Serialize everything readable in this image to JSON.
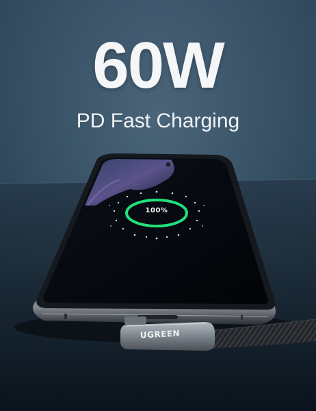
{
  "headline": "60W",
  "subtitle": "PD Fast Charging",
  "charge_indicator": {
    "percent_label": "100%",
    "ring_color": "#22e07a"
  },
  "brand_label": "UGREEN",
  "colors": {
    "background_top": "#2c4459",
    "background_bottom": "#0c1620",
    "screen": "#05080c",
    "phone_frame": "#5a6168",
    "cable_connector": "#8f979f"
  },
  "icons": [
    "wallpaper-graphic",
    "charging-ring",
    "charging-dots",
    "usb-c-cable"
  ]
}
